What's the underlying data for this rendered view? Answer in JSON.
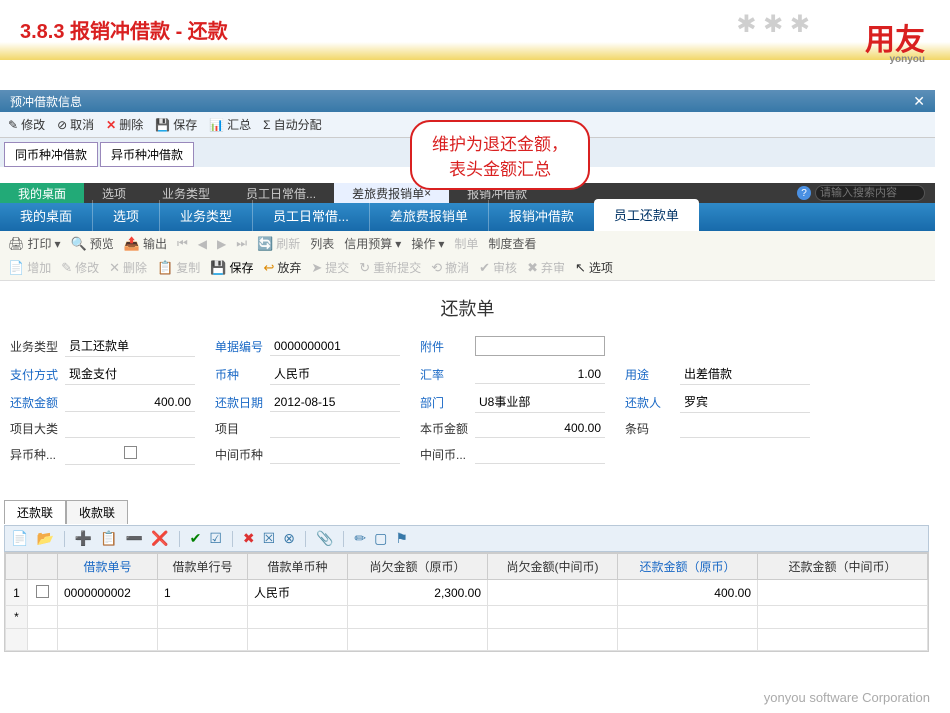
{
  "slide": {
    "title": "3.8.3 报销冲借款 - 还款",
    "logo": "用友",
    "logo_sub": "yonyou"
  },
  "layer1": {
    "title": "预冲借款信息",
    "toolbar": {
      "edit": "修改",
      "cancel": "取消",
      "delete": "删除",
      "save": "保存",
      "sum": "汇总",
      "auto": "自动分配"
    },
    "tabs": {
      "t1": "同币种冲借款",
      "t2": "异币种冲借款"
    }
  },
  "callout": {
    "l1": "维护为退还金额，",
    "l2": "表头金额汇总"
  },
  "dark_tabs": {
    "t1": "我的桌面",
    "t2": "选项",
    "t3": "业务类型",
    "t4": "员工日常借...",
    "t5": "差旅费报销单",
    "t6": "报销冲借款",
    "search_ph": "请输入搜索内容"
  },
  "blue_tabs": {
    "t1": "我的桌面",
    "t2": "选项",
    "t3": "业务类型",
    "t4": "员工日常借...",
    "t5": "差旅费报销单",
    "t6": "报销冲借款",
    "t7": "员工还款单"
  },
  "toolbar2": {
    "print": "打印",
    "preview": "预览",
    "output": "输出",
    "refresh": "刷新",
    "list": "列表",
    "credit": "信用预算",
    "op": "操作",
    "make": "制单",
    "system": "制度查看"
  },
  "toolbar3": {
    "add": "增加",
    "edit": "修改",
    "delete": "删除",
    "copy": "复制",
    "save": "保存",
    "abandon": "放弃",
    "submit": "提交",
    "resubmit": "重新提交",
    "undo": "撤消",
    "audit": "审核",
    "unaudit": "弃审",
    "option": "选项"
  },
  "doc_title": "还款单",
  "form": {
    "r1": {
      "l1": "业务类型",
      "v1": "员工还款单",
      "l2": "单据编号",
      "v2": "0000000001",
      "l3": "附件",
      "v3": ""
    },
    "r2": {
      "l1": "支付方式",
      "v1": "现金支付",
      "l2": "币种",
      "v2": "人民币",
      "l3": "汇率",
      "v3": "1.00",
      "l4": "用途",
      "v4": "出差借款"
    },
    "r3": {
      "l1": "还款金额",
      "v1": "400.00",
      "l2": "还款日期",
      "v2": "2012-08-15",
      "l3": "部门",
      "v3": "U8事业部",
      "l4": "还款人",
      "v4": "罗宾"
    },
    "r4": {
      "l1": "项目大类",
      "v1": "",
      "l2": "项目",
      "v2": "",
      "l3": "本币金额",
      "v3": "400.00",
      "l4": "条码",
      "v4": ""
    },
    "r5": {
      "l1": "异币种...",
      "l2": "中间币种",
      "l3": "中间币..."
    }
  },
  "subtabs": {
    "t1": "还款联",
    "t2": "收款联"
  },
  "grid": {
    "headers": {
      "h1": "借款单号",
      "h2": "借款单行号",
      "h3": "借款单币种",
      "h4": "尚欠金额（原币）",
      "h5": "尚欠金额(中间币)",
      "h6": "还款金额（原币）",
      "h7": "还款金额（中间币）"
    },
    "rows": [
      {
        "num": "1",
        "c1": "0000000002",
        "c2": "1",
        "c3": "人民币",
        "c4": "2,300.00",
        "c5": "",
        "c6": "400.00",
        "c7": ""
      }
    ]
  },
  "footer": "yonyou software Corporation"
}
